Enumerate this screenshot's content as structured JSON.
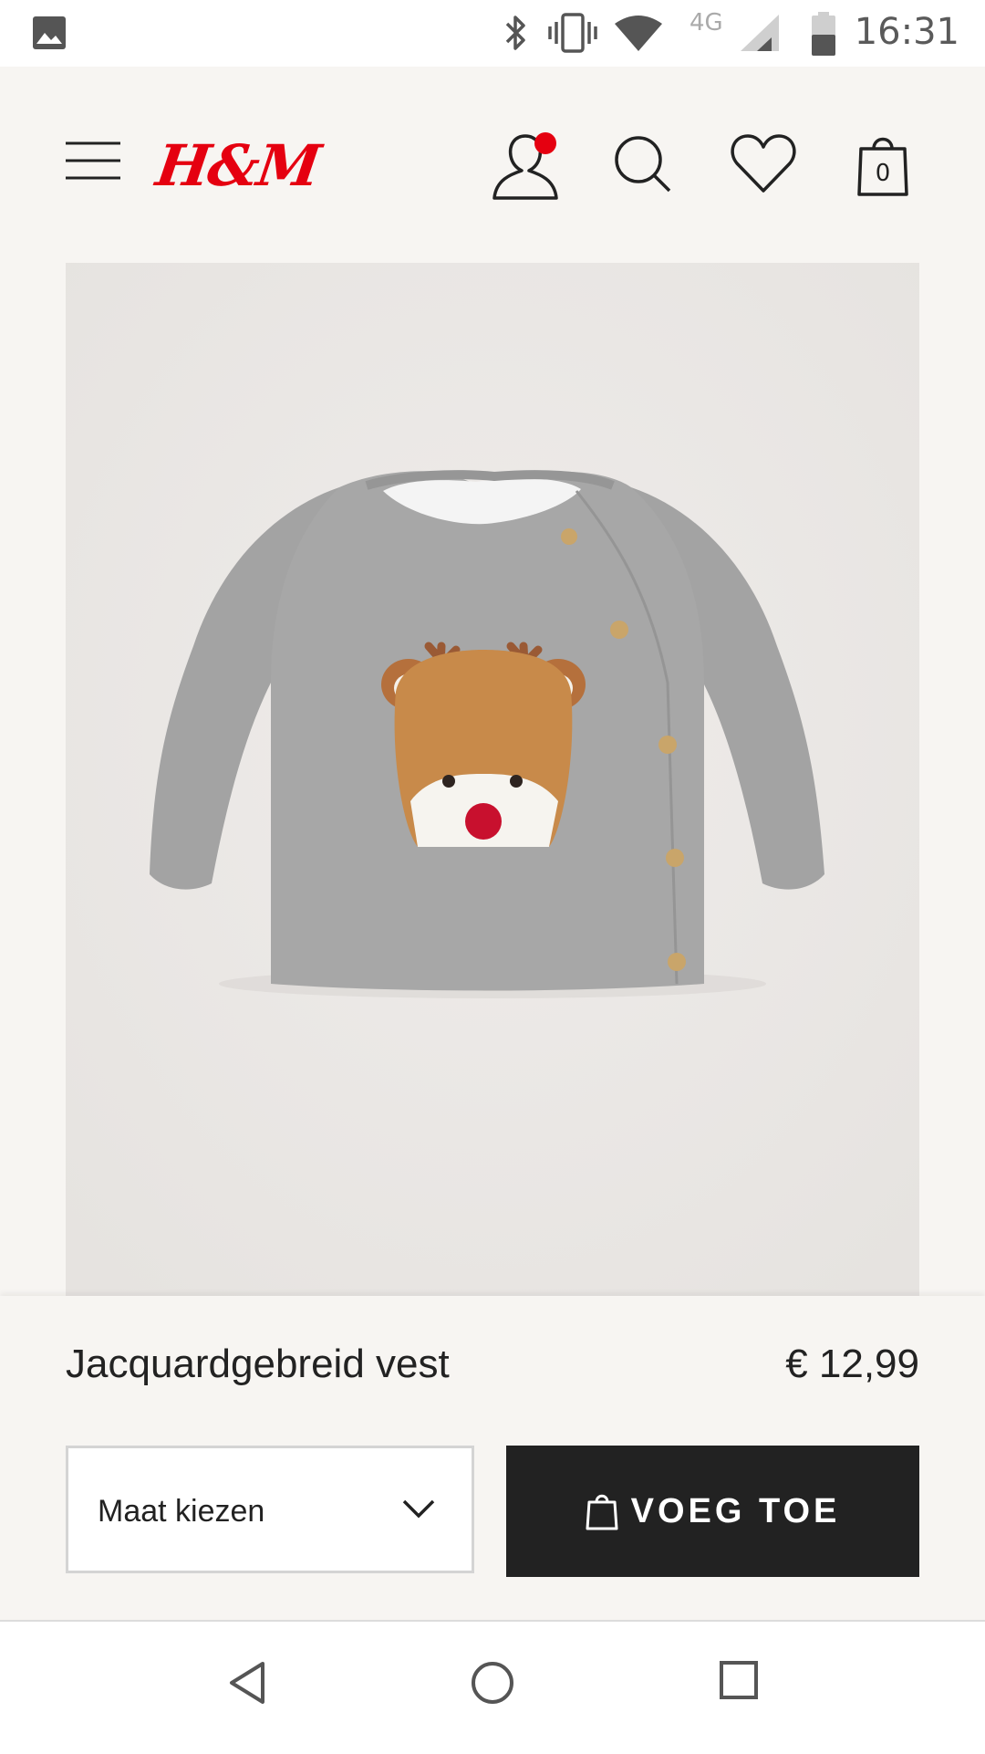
{
  "status_bar": {
    "time": "16:31",
    "network": "4G",
    "icons": [
      "gallery-icon",
      "bluetooth-icon",
      "vibrate-icon",
      "wifi-icon",
      "cell-signal-icon",
      "battery-icon"
    ]
  },
  "header": {
    "brand": "H&M",
    "brand_color": "#e50010",
    "cart_count": "0",
    "icons": [
      "menu-icon",
      "account-icon",
      "search-icon",
      "heart-icon",
      "shopping-bag-icon"
    ],
    "notification_dot_color": "#e50010"
  },
  "product": {
    "name": "Jacquardgebreid vest",
    "price": "€ 12,99",
    "size_select_label": "Maat kiezen",
    "add_button_label": "VOEG TOE"
  },
  "nav_bar": {
    "icons": [
      "back-icon",
      "home-icon",
      "recents-icon"
    ]
  }
}
